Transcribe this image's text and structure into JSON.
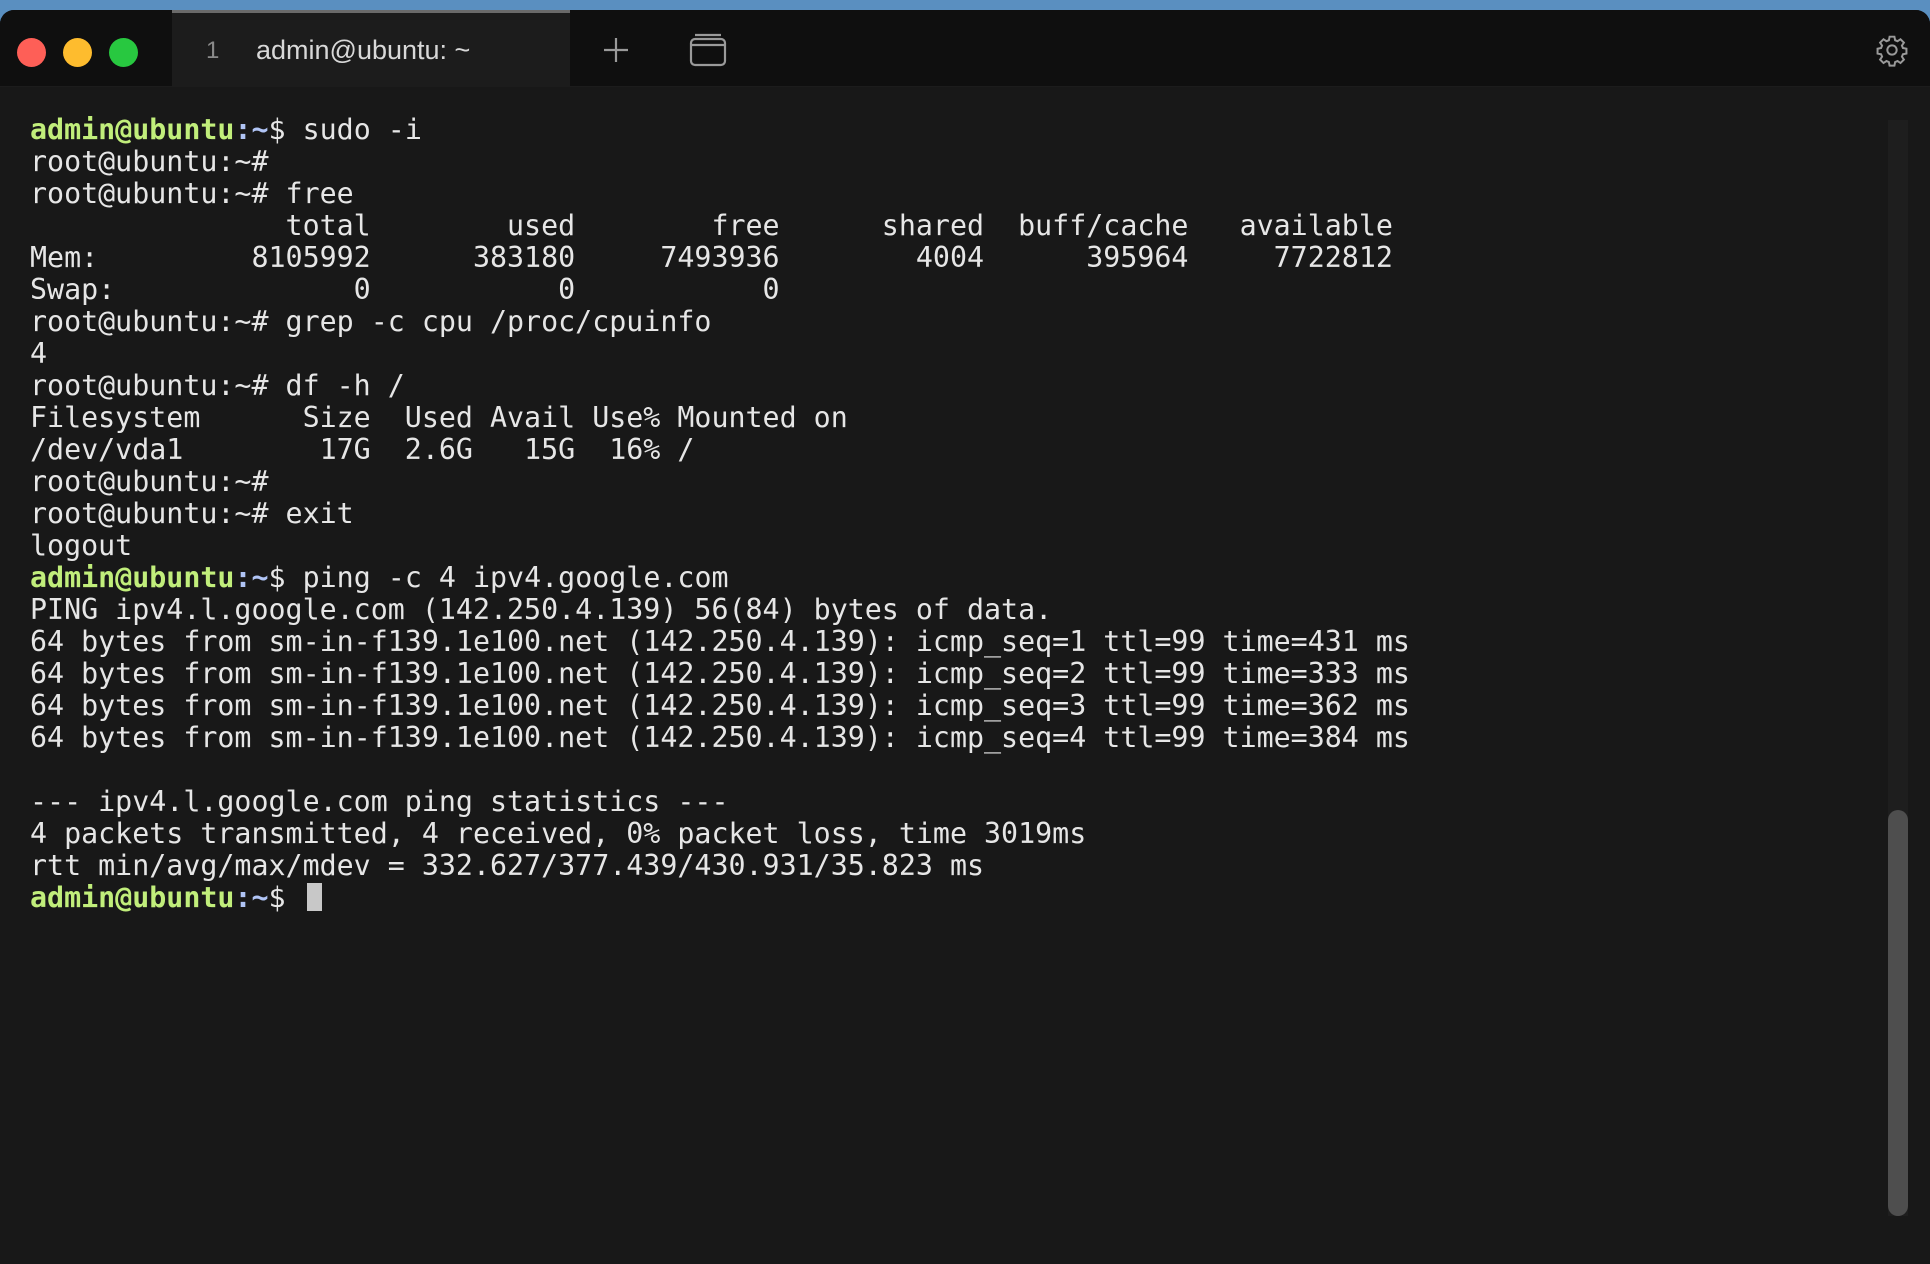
{
  "tab": {
    "index": "1",
    "title": "admin@ubuntu: ~"
  },
  "colors": {
    "user_prompt": "#c1ee7b",
    "path": "#b0c4f5",
    "text": "#e6e6e6",
    "background": "#181818"
  },
  "icons": {
    "new_tab": "plus-icon",
    "tab_overview": "tabs-overview-icon",
    "settings": "gear-icon"
  },
  "terminal": {
    "lines": [
      {
        "user": "admin@ubuntu",
        "path": "~",
        "sym": "$",
        "cmd": " sudo -i"
      },
      {
        "text": "root@ubuntu:~#"
      },
      {
        "text": "root@ubuntu:~# free"
      },
      {
        "text": "               total        used        free      shared  buff/cache   available"
      },
      {
        "text": "Mem:         8105992      383180     7493936        4004      395964     7722812"
      },
      {
        "text": "Swap:              0           0           0"
      },
      {
        "text": "root@ubuntu:~# grep -c cpu /proc/cpuinfo"
      },
      {
        "text": "4"
      },
      {
        "text": "root@ubuntu:~# df -h /"
      },
      {
        "text": "Filesystem      Size  Used Avail Use% Mounted on"
      },
      {
        "text": "/dev/vda1        17G  2.6G   15G  16% /"
      },
      {
        "text": "root@ubuntu:~#"
      },
      {
        "text": "root@ubuntu:~# exit"
      },
      {
        "text": "logout"
      },
      {
        "user": "admin@ubuntu",
        "path": "~",
        "sym": "$",
        "cmd": " ping -c 4 ipv4.google.com"
      },
      {
        "text": "PING ipv4.l.google.com (142.250.4.139) 56(84) bytes of data."
      },
      {
        "text": "64 bytes from sm-in-f139.1e100.net (142.250.4.139): icmp_seq=1 ttl=99 time=431 ms"
      },
      {
        "text": "64 bytes from sm-in-f139.1e100.net (142.250.4.139): icmp_seq=2 ttl=99 time=333 ms"
      },
      {
        "text": "64 bytes from sm-in-f139.1e100.net (142.250.4.139): icmp_seq=3 ttl=99 time=362 ms"
      },
      {
        "text": "64 bytes from sm-in-f139.1e100.net (142.250.4.139): icmp_seq=4 ttl=99 time=384 ms"
      },
      {
        "text": ""
      },
      {
        "text": "--- ipv4.l.google.com ping statistics ---"
      },
      {
        "text": "4 packets transmitted, 4 received, 0% packet loss, time 3019ms"
      },
      {
        "text": "rtt min/avg/max/mdev = 332.627/377.439/430.931/35.823 ms"
      },
      {
        "user": "admin@ubuntu",
        "path": "~",
        "sym": "$",
        "cmd": " ",
        "cursor": true
      }
    ]
  }
}
